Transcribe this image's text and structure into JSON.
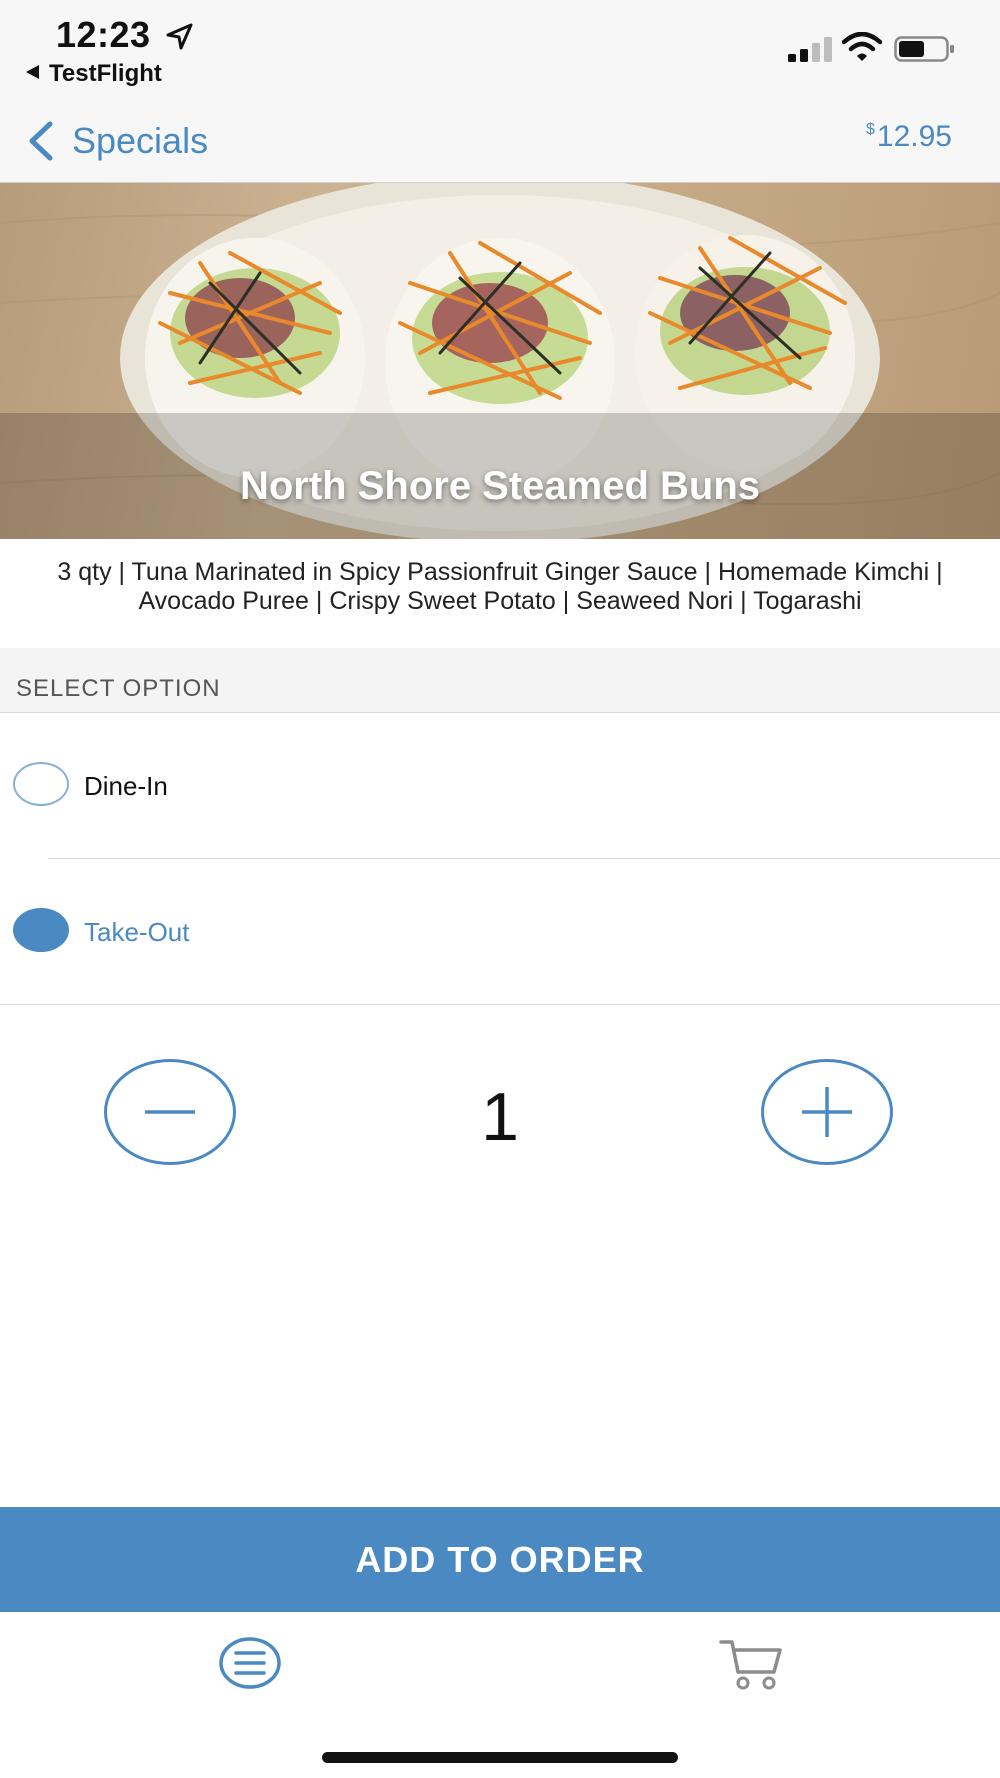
{
  "status_bar": {
    "time": "12:23",
    "back_app": "TestFlight",
    "icons": [
      "location-arrow-icon",
      "cellular-signal-icon",
      "wifi-icon",
      "battery-icon"
    ]
  },
  "nav": {
    "back_title": "Specials",
    "price_currency": "$",
    "price_amount": "12.95"
  },
  "item": {
    "title": "North Shore Steamed Buns",
    "description": "3 qty | Tuna Marinated in Spicy Passionfruit Ginger Sauce | Homemade Kimchi | Avocado Puree | Crispy Sweet Potato | Seaweed Nori | Togarashi"
  },
  "options": {
    "header": "SELECT OPTION",
    "items": [
      {
        "label": "Dine-In",
        "selected": false
      },
      {
        "label": "Take-Out",
        "selected": true
      }
    ]
  },
  "quantity": {
    "value": "1",
    "decrement_icon": "minus-icon",
    "increment_icon": "plus-icon"
  },
  "add_button": {
    "label": "ADD TO ORDER"
  },
  "tab_bar": {
    "items": [
      {
        "icon": "menu-list-icon"
      },
      {
        "icon": "cart-icon"
      }
    ]
  },
  "colors": {
    "accent": "#4a89c2",
    "header_bg": "#f7f7f7",
    "section_bg": "#f4f4f4"
  }
}
